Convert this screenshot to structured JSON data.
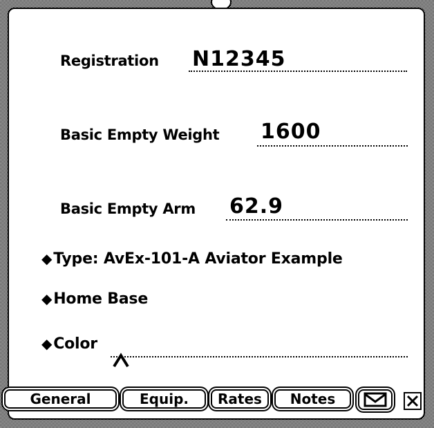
{
  "fields": [
    {
      "label": "Registration",
      "value": "N12345"
    },
    {
      "label": "Basic Empty Weight",
      "value": "1600"
    },
    {
      "label": "Basic Empty Arm",
      "value": "62.9"
    }
  ],
  "pickers": [
    {
      "label": "Type: AvEx-101-A Aviator Example"
    },
    {
      "label": "Home Base"
    },
    {
      "label": "Color"
    }
  ],
  "buttons": {
    "general": "General",
    "equip": "Equip.",
    "rates": "Rates",
    "notes": "Notes"
  },
  "icons": {
    "routing": "envelope-icon",
    "close": "close-icon",
    "caret": "insertion-caret-icon",
    "diamond": "diamond-icon"
  }
}
